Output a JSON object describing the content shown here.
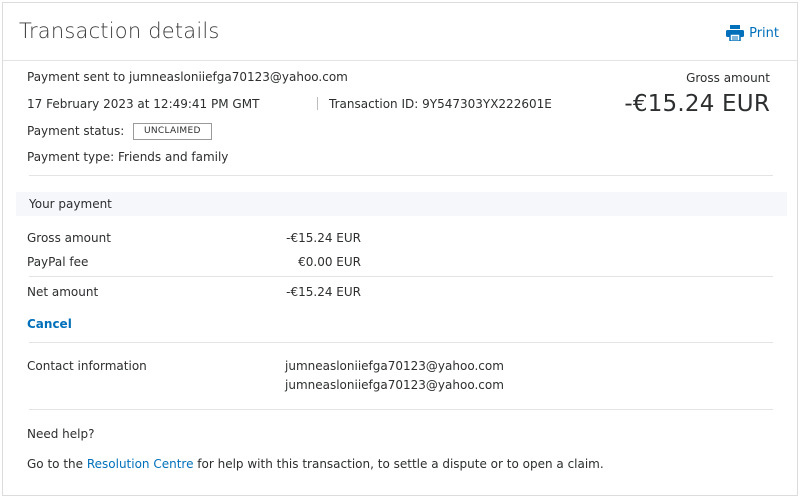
{
  "header": {
    "title": "Transaction details",
    "print_label": "Print"
  },
  "transaction": {
    "sent_to": "Payment sent to jumneasloniiefga70123@yahoo.com",
    "date": "17 February 2023 at 12:49:41 PM GMT",
    "transaction_id": "Transaction ID: 9Y547303YX222601E",
    "status_label": "Payment status:",
    "status_value": "UNCLAIMED",
    "type": "Payment type: Friends and family",
    "gross_label": "Gross amount",
    "gross_value": "-€15.24 EUR"
  },
  "your_payment": {
    "heading": "Your payment",
    "rows": [
      {
        "label": "Gross amount",
        "value": "-€15.24 EUR"
      },
      {
        "label": "PayPal fee",
        "value": "€0.00 EUR"
      },
      {
        "label": "Net amount",
        "value": "-€15.24 EUR"
      }
    ],
    "cancel_label": "Cancel"
  },
  "contact": {
    "label": "Contact information",
    "emails": [
      "jumneasloniiefga70123@yahoo.com",
      "jumneasloniiefga70123@yahoo.com"
    ]
  },
  "help": {
    "title": "Need help?",
    "text_before": "Go to the ",
    "link": "Resolution Centre",
    "text_after": " for help with this transaction, to settle a dispute or to open a claim."
  },
  "colors": {
    "link": "#0070ba",
    "section_bg": "#f5f7fa",
    "text": "#2c2e2f"
  }
}
